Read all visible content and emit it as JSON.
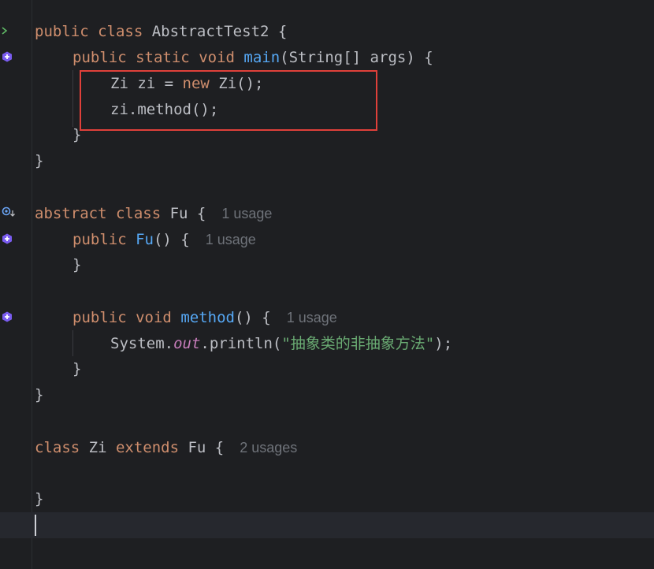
{
  "editor": {
    "lines": {
      "l1": {
        "a": "public",
        "b": " ",
        "c": "class",
        "d": " AbstractTest2 {"
      },
      "l2": {
        "a": "public",
        "b": " ",
        "c": "static",
        "d": " ",
        "e": "void",
        "f": " ",
        "g": "main",
        "h": "(String[] args) {"
      },
      "l3": {
        "a": "Zi zi = ",
        "b": "new",
        "c": " Zi();"
      },
      "l4": {
        "a": "zi.method();"
      },
      "l5": {
        "a": "}"
      },
      "l6": {
        "a": "}"
      },
      "l7": {
        "a": "abstract",
        "b": " ",
        "c": "class",
        "d": " Fu {",
        "hint": "1 usage"
      },
      "l8": {
        "a": "public",
        "b": " ",
        "c": "Fu",
        "d": "() {",
        "hint": "1 usage"
      },
      "l9": {
        "a": "}"
      },
      "l10": {
        "a": "public",
        "b": " ",
        "c": "void",
        "d": " ",
        "e": "method",
        "f": "() {",
        "hint": "1 usage"
      },
      "l11": {
        "a": "System.",
        "b": "out",
        "c": ".println(",
        "d": "\"抽象类的非抽象方法\"",
        "e": ");"
      },
      "l12": {
        "a": "}"
      },
      "l13": {
        "a": "}"
      },
      "l14": {
        "a": "class",
        "b": " Zi ",
        "c": "extends",
        "d": " Fu {",
        "hint": "2 usages"
      },
      "l15": {
        "a": "}"
      }
    },
    "colors": {
      "background": "#1e1f22",
      "keyword": "#cf8e6d",
      "function": "#56a8f5",
      "string": "#6aab73",
      "static_field": "#c77dbb",
      "hint": "#6f737a",
      "highlight_border": "#e0403a"
    },
    "gutter_icons": [
      "run-icon",
      "implementation-icon",
      "overridden-icon",
      "implementation-icon",
      "implementation-icon"
    ]
  }
}
